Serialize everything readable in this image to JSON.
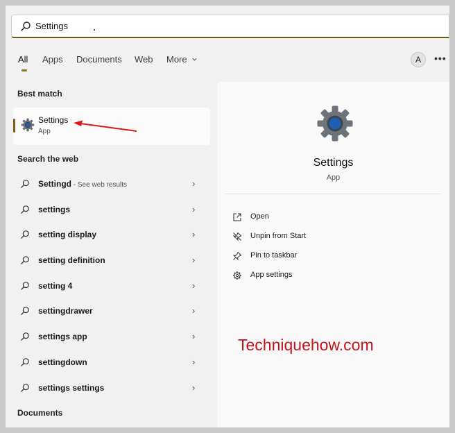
{
  "search": {
    "value": "Settings"
  },
  "tabs": [
    {
      "label": "All"
    },
    {
      "label": "Apps"
    },
    {
      "label": "Documents"
    },
    {
      "label": "Web"
    },
    {
      "label": "More"
    }
  ],
  "header": {
    "avatar_letter": "A",
    "more_options": "•••"
  },
  "best_match": {
    "section_title": "Best match",
    "name": "Settings",
    "type": "App"
  },
  "search_web": {
    "section_title": "Search the web",
    "items": [
      {
        "query": "Settingd",
        "extra": " - See web results"
      },
      {
        "query": "settings",
        "extra": ""
      },
      {
        "query": "setting display",
        "extra": ""
      },
      {
        "query": "setting definition",
        "extra": ""
      },
      {
        "query": "setting 4",
        "extra": ""
      },
      {
        "query": "settingdrawer",
        "extra": ""
      },
      {
        "query": "settings app",
        "extra": ""
      },
      {
        "query": "settingdown",
        "extra": ""
      },
      {
        "query": "settings settings",
        "extra": ""
      }
    ]
  },
  "documents": {
    "section_title": "Documents"
  },
  "preview": {
    "title": "Settings",
    "subtitle": "App",
    "actions": [
      {
        "label": "Open",
        "icon": "open-external-icon"
      },
      {
        "label": "Unpin from Start",
        "icon": "unpin-icon"
      },
      {
        "label": "Pin to taskbar",
        "icon": "pin-icon"
      },
      {
        "label": "App settings",
        "icon": "gear-icon"
      }
    ]
  },
  "watermark": "Techniquehow.com",
  "colors": {
    "accent": "#7a5f16",
    "gear_blue": "#1d5fb8",
    "watermark_red": "#c4141b"
  }
}
